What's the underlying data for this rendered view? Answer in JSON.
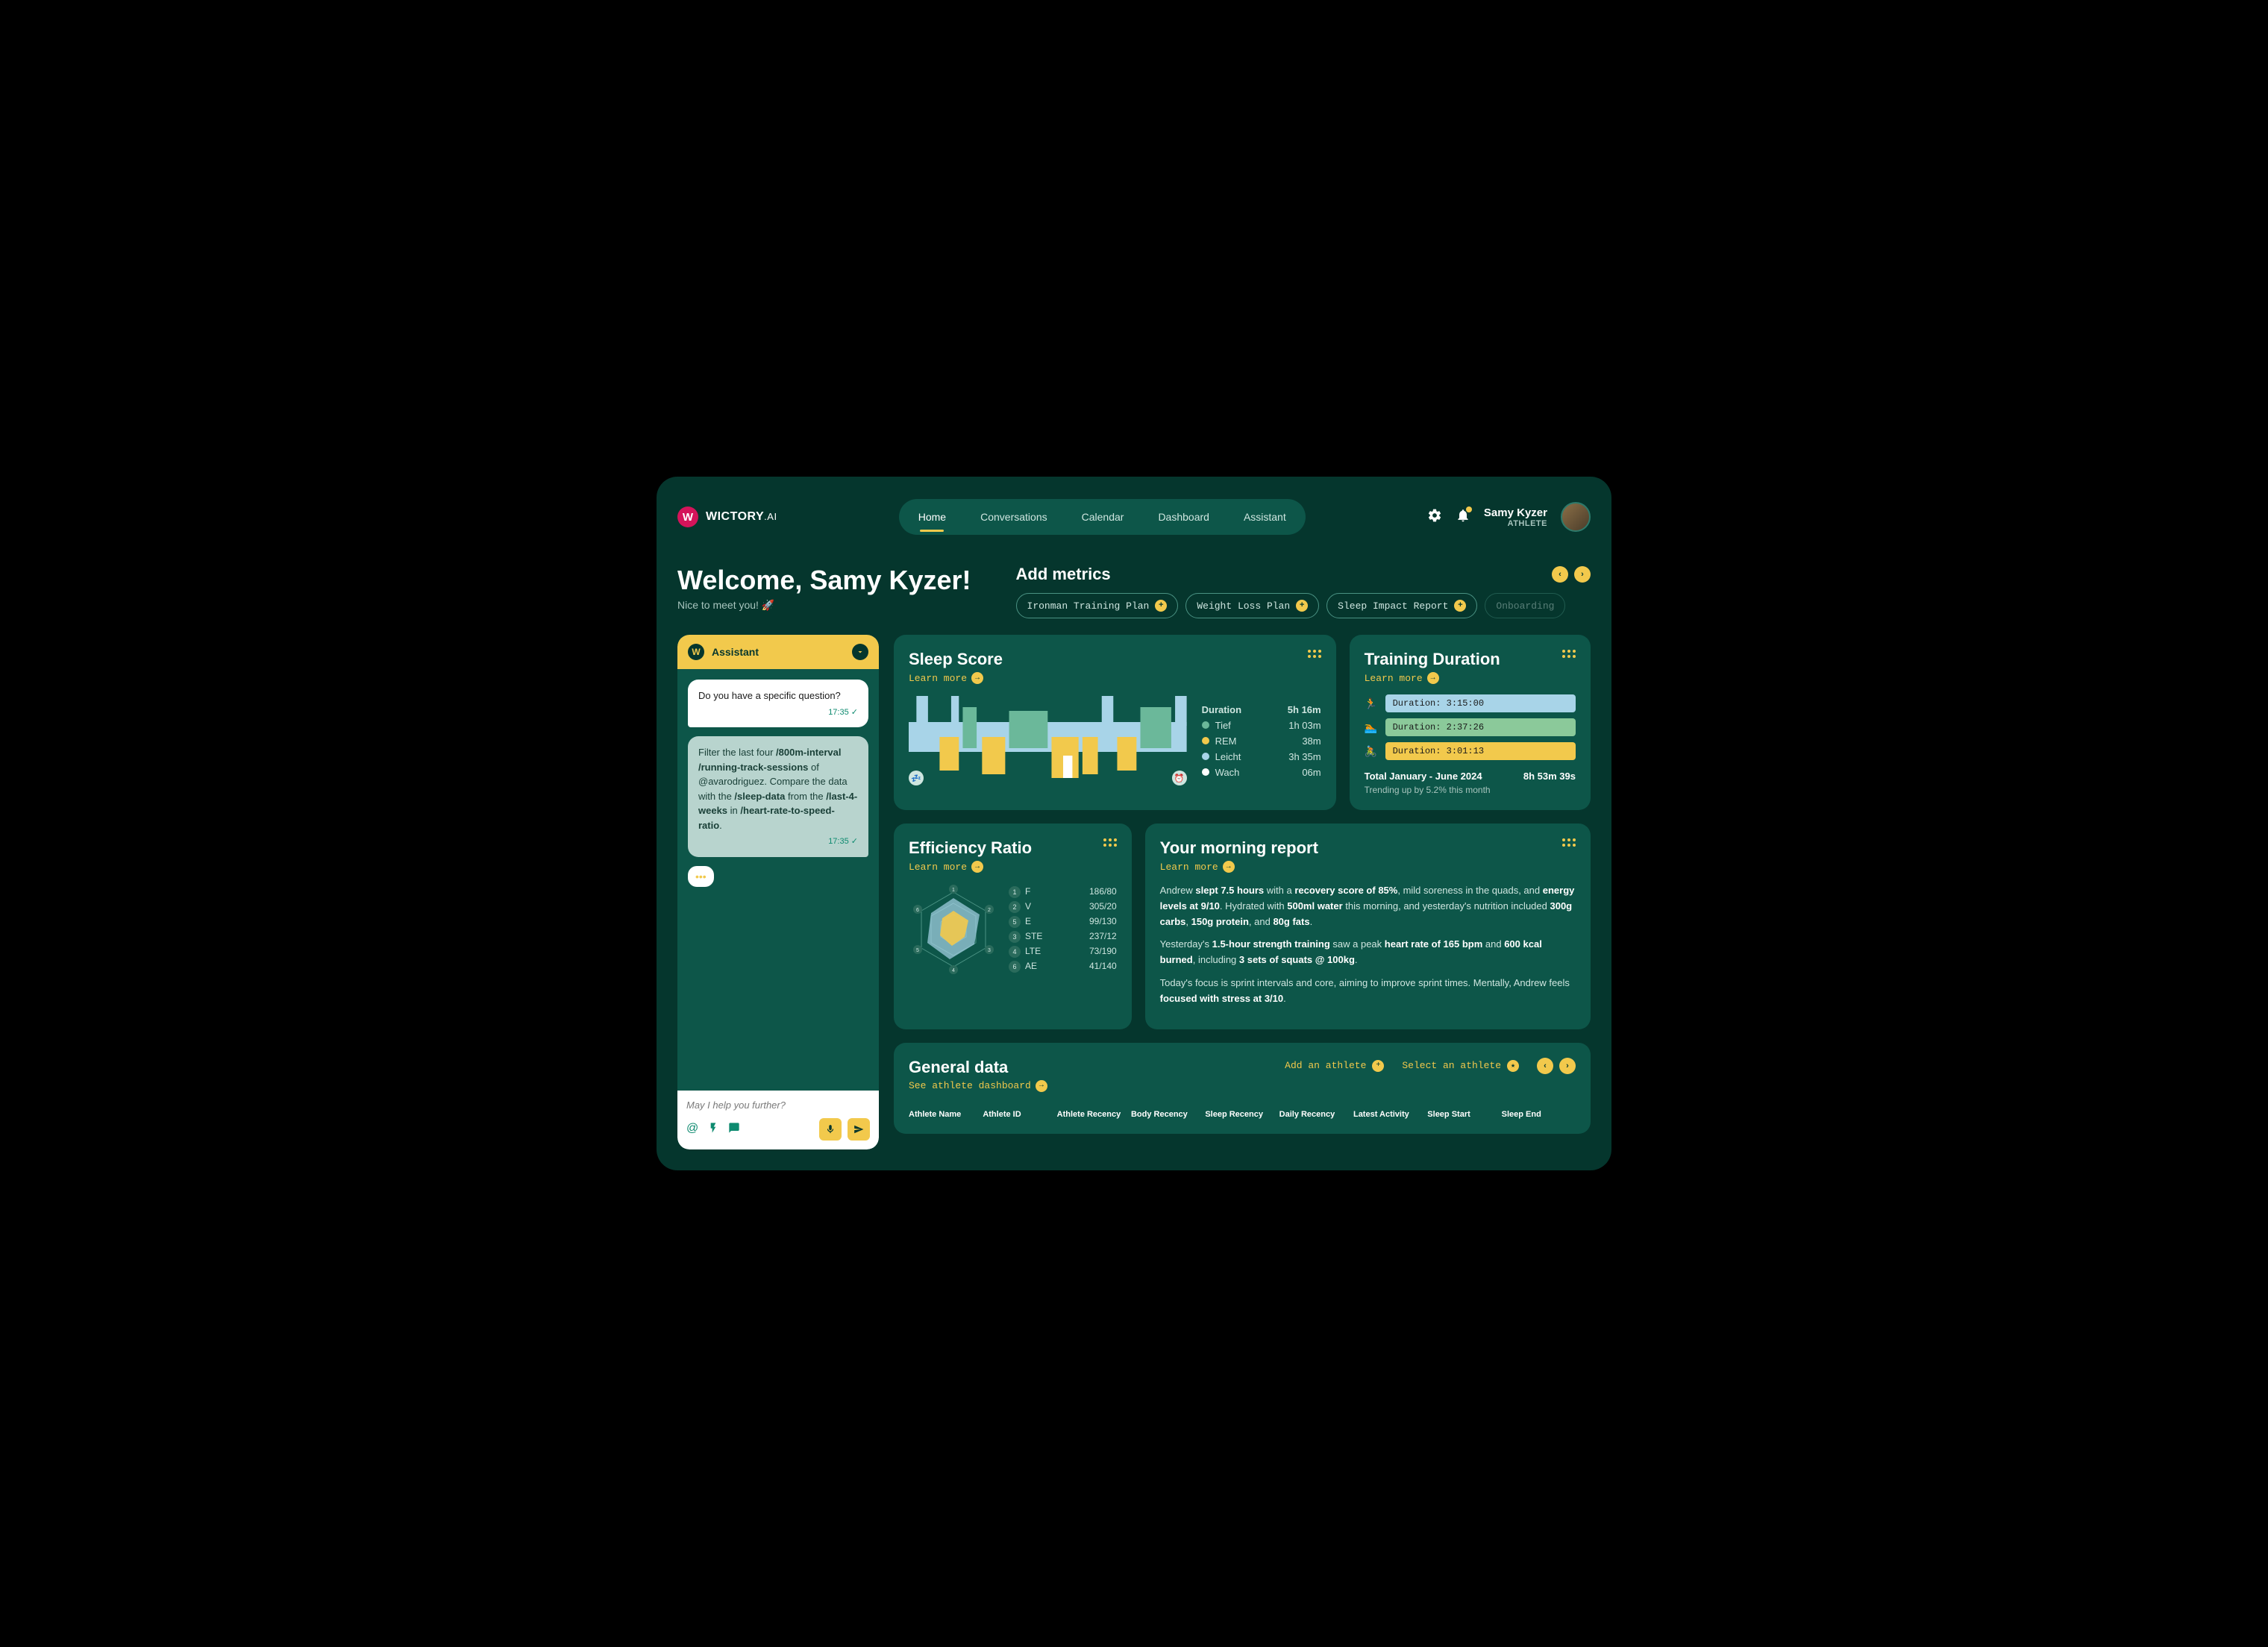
{
  "brand": {
    "name": "WICTORY",
    "suffix": ".AI",
    "badge": "W"
  },
  "nav": {
    "items": [
      "Home",
      "Conversations",
      "Calendar",
      "Dashboard",
      "Assistant"
    ],
    "active": 0
  },
  "user": {
    "name": "Samy Kyzer",
    "role": "ATHLETE"
  },
  "welcome": {
    "heading": "Welcome, Samy Kyzer!",
    "subtitle": "Nice to meet you! 🚀"
  },
  "metrics": {
    "title": "Add metrics",
    "chips": [
      {
        "label": "Ironman Training Plan",
        "faded": false
      },
      {
        "label": "Weight Loss Plan",
        "faded": false
      },
      {
        "label": "Sleep Impact Report",
        "faded": false
      },
      {
        "label": "Onboarding",
        "faded": true
      }
    ]
  },
  "assistant": {
    "title": "Assistant",
    "messages": [
      {
        "role": "bot",
        "text": "Do you have a specific question?",
        "time": "17:35"
      },
      {
        "role": "user",
        "html": "Filter the last four <b>/800m-interval /running-track-sessions</b> of @avarodriguez. Compare the data with the <b>/sleep-data</b> from the <b>/last-4-weeks</b> in <b>/heart-rate-to-speed-ratio</b>.",
        "time": "17:35"
      }
    ],
    "placeholder": "May I help you further?"
  },
  "sleep": {
    "title": "Sleep Score",
    "learn": "Learn more",
    "duration_label": "Duration",
    "duration_value": "5h 16m",
    "phases": [
      {
        "name": "Tief",
        "color": "#6bb89a",
        "value": "1h 03m"
      },
      {
        "name": "REM",
        "color": "#f2c94c",
        "value": "38m"
      },
      {
        "name": "Leicht",
        "color": "#a8d4e8",
        "value": "3h 35m"
      },
      {
        "name": "Wach",
        "color": "#ffffff",
        "value": "06m"
      }
    ]
  },
  "training": {
    "title": "Training Duration",
    "learn": "Learn more",
    "rows": [
      {
        "icon": "run",
        "label": "Duration: 3:15:00",
        "color": "#a8d4e8",
        "width": "100%"
      },
      {
        "icon": "swim",
        "label": "Duration: 2:37:26",
        "color": "#8bc99a",
        "width": "80%"
      },
      {
        "icon": "bike",
        "label": "Duration: 3:01:13",
        "color": "#f2c94c",
        "width": "92%"
      }
    ],
    "total_label": "Total January - June 2024",
    "total_value": "8h 53m 39s",
    "trend": "Trending up by 5.2% this month"
  },
  "efficiency": {
    "title": "Efficiency Ratio",
    "learn": "Learn more",
    "metrics": [
      {
        "n": "1",
        "label": "F",
        "value": "186/80"
      },
      {
        "n": "2",
        "label": "V",
        "value": "305/20"
      },
      {
        "n": "5",
        "label": "E",
        "value": "99/130"
      },
      {
        "n": "3",
        "label": "STE",
        "value": "237/12"
      },
      {
        "n": "4",
        "label": "LTE",
        "value": "73/190"
      },
      {
        "n": "6",
        "label": "AE",
        "value": "41/140"
      }
    ]
  },
  "morning": {
    "title": "Your morning report",
    "learn": "Learn more",
    "p1": "Andrew <b>slept 7.5 hours</b> with a <b>recovery score of 85%</b>, mild soreness in the quads, and <b>energy levels at 9/10</b>. Hydrated with <b>500ml water</b> this morning, and yesterday's nutrition included <b>300g carbs</b>, <b>150g protein</b>, and <b>80g fats</b>.",
    "p2": "Yesterday's <b>1.5-hour strength training</b> saw a peak <b>heart rate of 165 bpm</b> and <b>600 kcal burned</b>, including <b>3 sets of squats @ 100kg</b>.",
    "p3": "Today's focus is sprint intervals and core, aiming to improve sprint times. Mentally, Andrew feels <b>focused with stress at 3/10</b>."
  },
  "general": {
    "title": "General data",
    "link": "See athlete dashboard",
    "add": "Add an athlete",
    "select": "Select an athlete",
    "columns": [
      "Athlete Name",
      "Athlete ID",
      "Athlete Recency",
      "Body Recency",
      "Sleep Recency",
      "Daily Recency",
      "Latest Activity",
      "Sleep Start",
      "Sleep End"
    ]
  },
  "chart_data": [
    {
      "type": "area",
      "title": "Sleep Score",
      "series_type": "sleep-stages-timeline",
      "total_duration": "5h 16m",
      "stages": [
        {
          "name": "Tief",
          "duration": "1h 03m",
          "color": "#6bb89a"
        },
        {
          "name": "REM",
          "duration": "38m",
          "color": "#f2c94c"
        },
        {
          "name": "Leicht",
          "duration": "3h 35m",
          "color": "#a8d4e8"
        },
        {
          "name": "Wach",
          "duration": "06m",
          "color": "#ffffff"
        }
      ]
    },
    {
      "type": "bar",
      "title": "Training Duration",
      "orientation": "horizontal",
      "categories": [
        "Run",
        "Swim",
        "Bike"
      ],
      "values_label": [
        "3:15:00",
        "2:37:26",
        "3:01:13"
      ],
      "values_seconds": [
        11700,
        9446,
        10873
      ],
      "total": "8h 53m 39s",
      "period": "January - June 2024",
      "trend_pct": 5.2
    },
    {
      "type": "area",
      "subtype": "radar",
      "title": "Efficiency Ratio",
      "categories": [
        "F",
        "V",
        "STE",
        "LTE",
        "E",
        "AE"
      ],
      "series": [
        {
          "name": "outer",
          "values": [
            186,
            305,
            237,
            73,
            99,
            41
          ],
          "color": "#a8d4e8"
        },
        {
          "name": "inner",
          "values": [
            80,
            20,
            12,
            190,
            130,
            140
          ],
          "color": "#f2c94c"
        }
      ],
      "raw_pairs": {
        "F": "186/80",
        "V": "305/20",
        "STE": "237/12",
        "LTE": "73/190",
        "E": "99/130",
        "AE": "41/140"
      }
    }
  ]
}
